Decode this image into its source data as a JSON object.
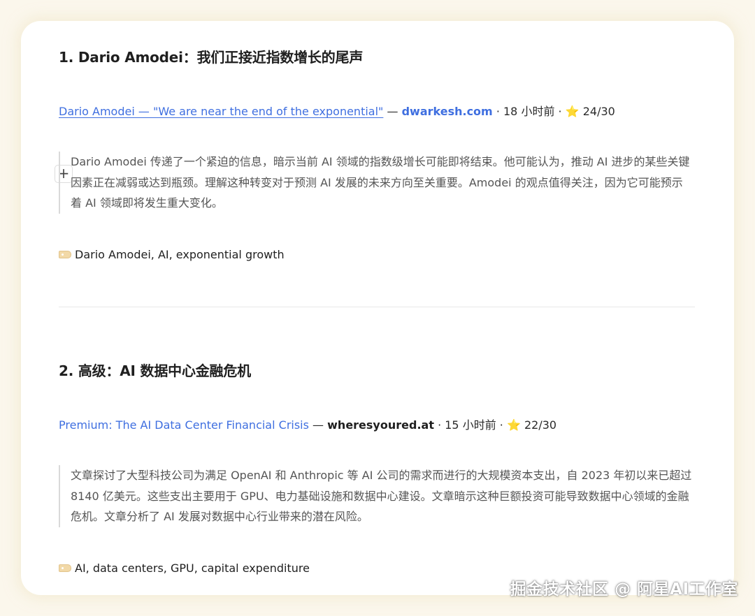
{
  "articles": [
    {
      "heading": "1. Dario Amodei：我们正接近指数增长的尾声",
      "link_text": "Dario Amodei — \"We are near the end of the exponential\"",
      "separator": "—",
      "domain": "dwarkesh.com",
      "meta_sep1": "·",
      "time": "18 小时前",
      "meta_sep2": "·",
      "star": "⭐",
      "score": "24/30",
      "summary": "Dario Amodei 传递了一个紧迫的信息，暗示当前 AI 领域的指数级增长可能即将结束。他可能认为，推动 AI 进步的某些关键因素正在减弱或达到瓶颈。理解这种转变对于预测 AI 发展的未来方向至关重要。Amodei 的观点值得关注，因为它可能预示着 AI 领域即将发生重大变化。",
      "tags": "Dario Amodei, AI, exponential growth"
    },
    {
      "heading": "2. 高级：AI 数据中心金融危机",
      "link_text": "Premium: The AI Data Center Financial Crisis",
      "separator": "—",
      "domain": "wheresyoured.at",
      "meta_sep1": "·",
      "time": "15 小时前",
      "meta_sep2": "·",
      "star": "⭐",
      "score": "22/30",
      "summary": "文章探讨了大型科技公司为满足 OpenAI 和 Anthropic 等 AI 公司的需求而进行的大规模资本支出，自 2023 年初以来已超过 8140 亿美元。这些支出主要用于 GPU、电力基础设施和数据中心建设。文章暗示这种巨额投资可能导致数据中心领域的金融危机。文章分析了 AI 发展对数据中心行业带来的潜在风险。",
      "tags": "AI, data centers, GPU, capital expenditure"
    }
  ],
  "add_button_label": "+",
  "watermark": "掘金技术社区 @ 阿星AI工作室",
  "colors": {
    "link": "#3f6fe0",
    "star": "#f2b824",
    "background": "#fbf7ec",
    "quote_border": "#d9d9d9"
  },
  "icons": {
    "tag": "tag-icon",
    "add": "plus-icon",
    "star": "star-icon"
  }
}
